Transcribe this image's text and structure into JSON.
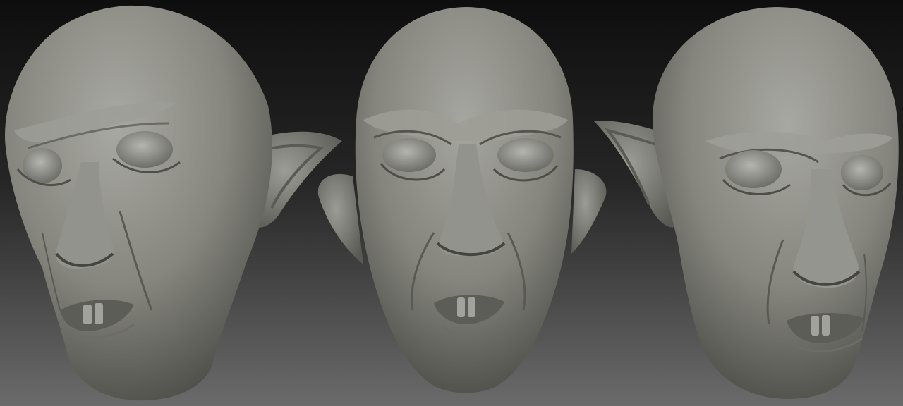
{
  "scene": {
    "description_visible_text": "",
    "background_top_color": "#0e0e0e",
    "background_bottom_color": "#6e6e6e",
    "material_color": "#8a8a84",
    "material_highlight_color": "#a8a8a2",
    "material_shadow_color": "#4a4a46",
    "views": [
      {
        "name": "head-view-three-quarter-left",
        "ear_icon": "pointed-ear-icon"
      },
      {
        "name": "head-view-front",
        "ear_icon": "pointed-ear-icon"
      },
      {
        "name": "head-view-three-quarter-right",
        "ear_icon": "pointed-ear-icon"
      }
    ]
  }
}
